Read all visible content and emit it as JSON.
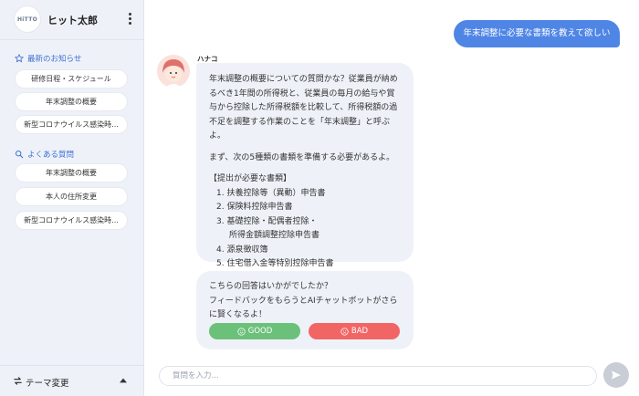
{
  "sidebar": {
    "logo_text": "HiTTO",
    "username": "ヒット太郎",
    "news": {
      "title": "最新のお知らせ",
      "icon": "star-icon",
      "items": [
        "研修日程・スケジュール",
        "年末調整の概要",
        "新型コロナウイルス感染時..."
      ]
    },
    "faq": {
      "title": "よくある質問",
      "icon": "search-icon",
      "items": [
        "年末調整の概要",
        "本人の住所変更",
        "新型コロナウイルス感染時..."
      ]
    },
    "footer": {
      "theme_label": "テーマ変更",
      "icon": "swap-icon"
    }
  },
  "chat": {
    "user_message": "年末調整に必要な書類を教えて欲しい",
    "bot_name": "ハナコ",
    "bot_message": {
      "intro": "年末調整の概要についての質問かな？従業員が納めるべき1年間の所得税と、従業員の毎月の給与や賞与から控除した所得税額を比較して、所得税額の過不足を調整する作業のことを「年末調整」と呼ぶよ。",
      "lead": "まず、次の5種類の書類を準備する必要があるよ。",
      "list_title": "【提出が必要な書類】",
      "items": [
        "1. 扶養控除等（異動）申告書",
        "2. 保険料控除申告書",
        "3. 基礎控除・配偶者控除・",
        "所得金額調整控除申告書",
        "4. 源泉徴収簿",
        "5. 住宅借入金等特別控除申告書"
      ]
    },
    "feedback": {
      "line1": "こちらの回答はいかがでしたか？",
      "line2": "フィードバックをもらうとAIチャットボットがさらに賢くなるよ！",
      "good_label": "GOOD",
      "bad_label": "BAD"
    }
  },
  "input": {
    "placeholder": "質問を入力..."
  },
  "colors": {
    "accent": "#4f86e6",
    "sidebar_bg": "#eef2f8",
    "good": "#6cc17a",
    "bad": "#f26565",
    "send": "#c9ced6"
  }
}
